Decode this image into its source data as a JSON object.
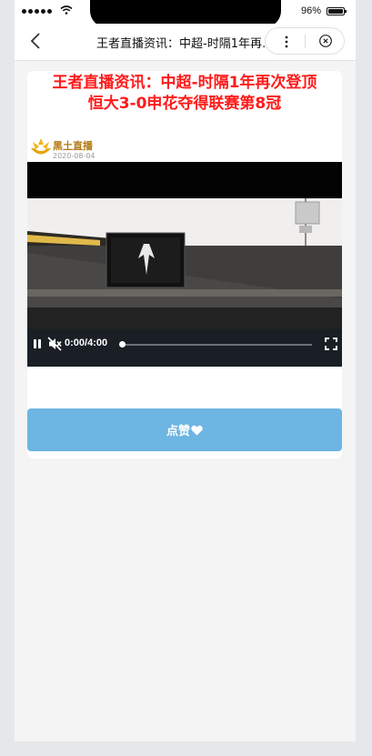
{
  "status_bar": {
    "battery": "96%"
  },
  "nav": {
    "title": "王者直播资讯：中超-时隔1年再次登顶恒大3-0申花夺得联赛第8冠"
  },
  "article": {
    "headline_line1": "王者直播资讯：中超-时隔1年再次登顶",
    "headline_line2": "恒大3-0申花夺得联赛第8冠",
    "headline_color": "#ff1a1a",
    "source": {
      "name": "黑土直播",
      "date": "2020-08-04"
    },
    "video": {
      "time": "0:00/4:00",
      "progress": 0
    },
    "like_label": "点赞",
    "like_color": "#6db5e3"
  },
  "icons": [
    "back-icon",
    "more-icon",
    "close-circle-icon",
    "pause-icon",
    "mute-icon",
    "fullscreen-icon",
    "heart-icon",
    "wifi-icon"
  ]
}
